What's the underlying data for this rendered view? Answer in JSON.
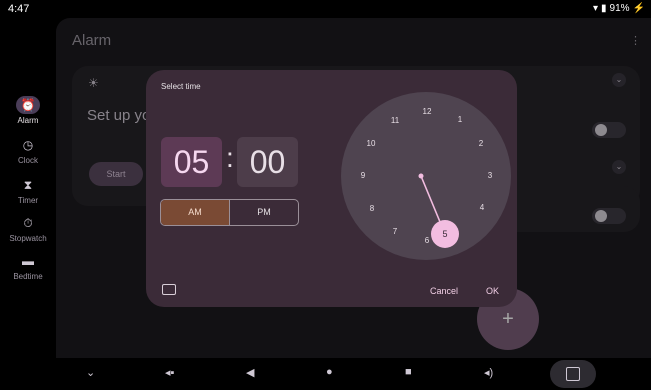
{
  "status_bar": {
    "time": "4:47",
    "battery": "91%"
  },
  "app": {
    "title": "Alarm"
  },
  "rail": {
    "items": [
      {
        "label": "Alarm",
        "icon": "alarm-icon",
        "active": true
      },
      {
        "label": "Clock",
        "icon": "clock-icon"
      },
      {
        "label": "Timer",
        "icon": "hourglass-icon"
      },
      {
        "label": "Stopwatch",
        "icon": "stopwatch-icon"
      },
      {
        "label": "Bedtime",
        "icon": "bed-icon"
      }
    ]
  },
  "background_card": {
    "text": "Set up yo",
    "start_label": "Start"
  },
  "fab": {
    "label": "+"
  },
  "dialog": {
    "title": "Select time",
    "hour": "05",
    "minute": "00",
    "colon": ":",
    "am_label": "AM",
    "pm_label": "PM",
    "selected_period": "AM",
    "clock_numbers": [
      "12",
      "1",
      "2",
      "3",
      "4",
      "5",
      "6",
      "7",
      "8",
      "9",
      "10",
      "11"
    ],
    "selected_number": "5",
    "cancel_label": "Cancel",
    "ok_label": "OK"
  },
  "colors": {
    "dialog_bg": "#3b2b38",
    "accent": "#f2bde0",
    "hour_selected_bg": "#5d3a55",
    "am_selected_bg": "#7a4a34"
  }
}
